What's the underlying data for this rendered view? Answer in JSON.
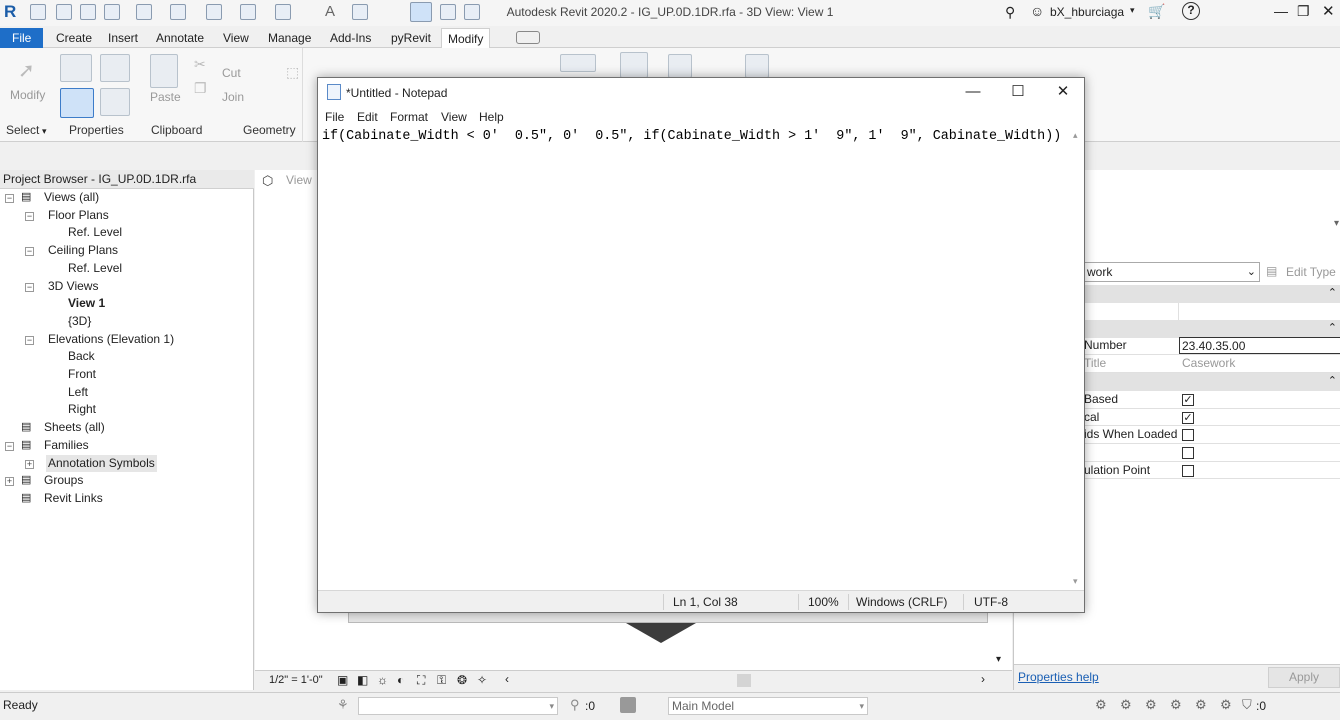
{
  "window": {
    "title": "Autodesk Revit 2020.2 - IG_UP.0D.1DR.rfa - 3D View: View 1",
    "user": "bX_hburciaga"
  },
  "menu": [
    "File",
    "Create",
    "Insert",
    "Annotate",
    "View",
    "Manage",
    "Add-Ins",
    "pyRevit",
    "Modify"
  ],
  "ribbon": {
    "modify": "Modify",
    "select": "Select",
    "properties": "Properties",
    "paste": "Paste",
    "clipboard": "Clipboard",
    "cut": "Cut",
    "join": "Join",
    "geometry": "Geometry"
  },
  "project_browser": {
    "title": "Project Browser - IG_UP.0D.1DR.rfa",
    "items": [
      {
        "label": "Views (all)",
        "level": 0,
        "exp": "-"
      },
      {
        "label": "Floor Plans",
        "level": 1,
        "exp": "-"
      },
      {
        "label": "Ref. Level",
        "level": 2
      },
      {
        "label": "Ceiling Plans",
        "level": 1,
        "exp": "-"
      },
      {
        "label": "Ref. Level",
        "level": 2
      },
      {
        "label": "3D Views",
        "level": 1,
        "exp": "-"
      },
      {
        "label": "View 1",
        "level": 2,
        "bold": true
      },
      {
        "label": "{3D}",
        "level": 2
      },
      {
        "label": "Elevations (Elevation 1)",
        "level": 1,
        "exp": "-"
      },
      {
        "label": "Back",
        "level": 2
      },
      {
        "label": "Front",
        "level": 2
      },
      {
        "label": "Left",
        "level": 2
      },
      {
        "label": "Right",
        "level": 2
      },
      {
        "label": "Sheets (all)",
        "level": 0
      },
      {
        "label": "Families",
        "level": 0,
        "exp": "-"
      },
      {
        "label": "Annotation Symbols",
        "level": 1,
        "exp": "+",
        "selected": true
      },
      {
        "label": "Groups",
        "level": 0,
        "exp": "+"
      },
      {
        "label": "Revit Links",
        "level": 0
      }
    ]
  },
  "view": {
    "tab": "View",
    "scale": "1/2\" = 1'-0\""
  },
  "properties": {
    "type_selector": "work",
    "edit_type": "Edit Type",
    "rows": [
      {
        "label": "Number",
        "value": "23.40.35.00"
      },
      {
        "label": "Title",
        "value": "Casework"
      },
      {
        "label": "Based",
        "checked": true
      },
      {
        "label": "cal",
        "checked": true
      },
      {
        "label": "ids When Loaded",
        "checked": false
      },
      {
        "label": "",
        "checked": false
      },
      {
        "label": "ulation Point",
        "checked": false
      }
    ],
    "help": "Properties help",
    "apply": "Apply"
  },
  "notepad": {
    "title": "*Untitled - Notepad",
    "menu": [
      "File",
      "Edit",
      "Format",
      "View",
      "Help"
    ],
    "text": "if(Cabinate_Width < 0'  0.5\", 0'  0.5\", if(Cabinate_Width > 1'  9\", 1'  9\", Cabinate_Width))",
    "status": {
      "pos": "Ln 1, Col 38",
      "zoom": "100%",
      "eol": "Windows (CRLF)",
      "enc": "UTF-8"
    }
  },
  "statusbar": {
    "ready": "Ready",
    "model": "Main Model",
    "count_a": ":0",
    "count_b": ":0"
  }
}
